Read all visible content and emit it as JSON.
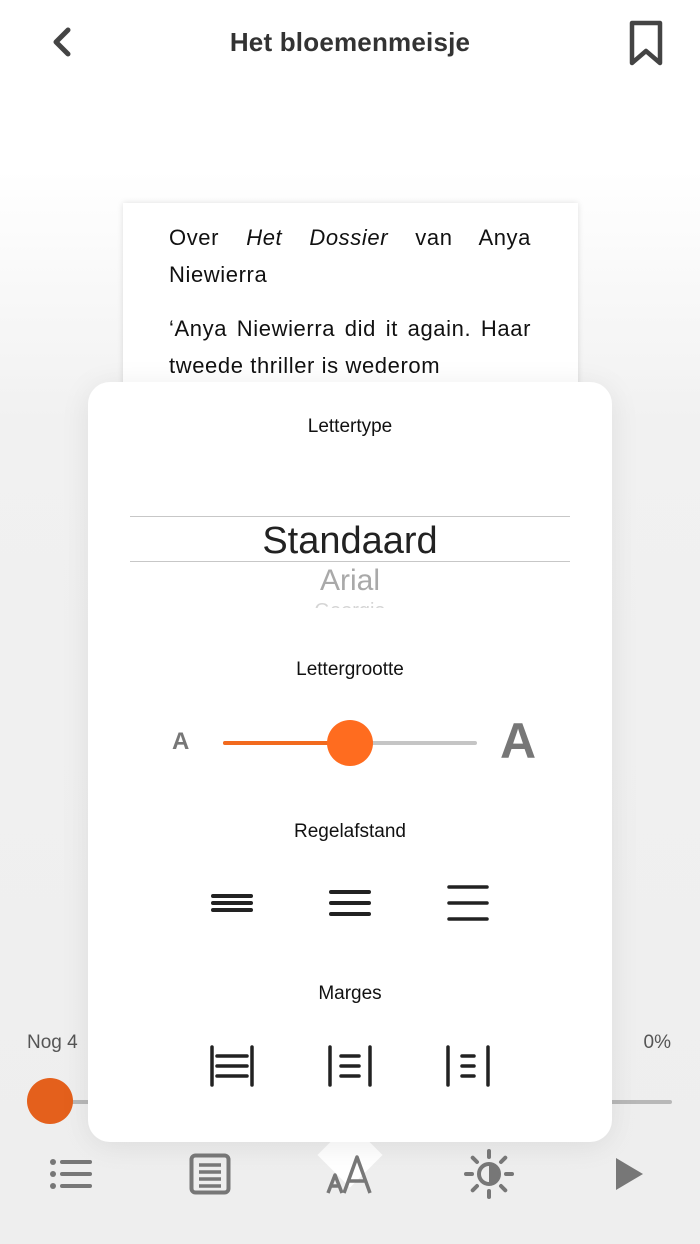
{
  "header": {
    "title": "Het bloemenmeisje",
    "back_icon": "chevron-left-icon",
    "bookmark_icon": "bookmark-icon"
  },
  "page": {
    "paragraph1_prefix": "Over ",
    "paragraph1_italic": "Het Dossier",
    "paragraph1_suffix": " van Anya Niewierra",
    "paragraph2": "‘Anya Niewierra did it again. Haar tweede thriller is wederom"
  },
  "settings": {
    "font_label": "Lettertype",
    "font_selected": "Standaard",
    "font_next": "Arial",
    "font_next2": "Georgia",
    "size_label": "Lettergrootte",
    "size_small_glyph": "A",
    "size_large_glyph": "A",
    "size_level": 0.5,
    "line_spacing_label": "Regelafstand",
    "margins_label": "Marges"
  },
  "progress": {
    "remaining_text": "Nog 4",
    "percent_text": "0%",
    "value": 0
  },
  "toolbar": {
    "icons": [
      "list-icon",
      "page-icon",
      "font-size-icon",
      "brightness-icon",
      "play-icon"
    ]
  },
  "colors": {
    "accent": "#ff6c1f",
    "accent_dark": "#e4601c",
    "icon_gray": "#777777"
  }
}
